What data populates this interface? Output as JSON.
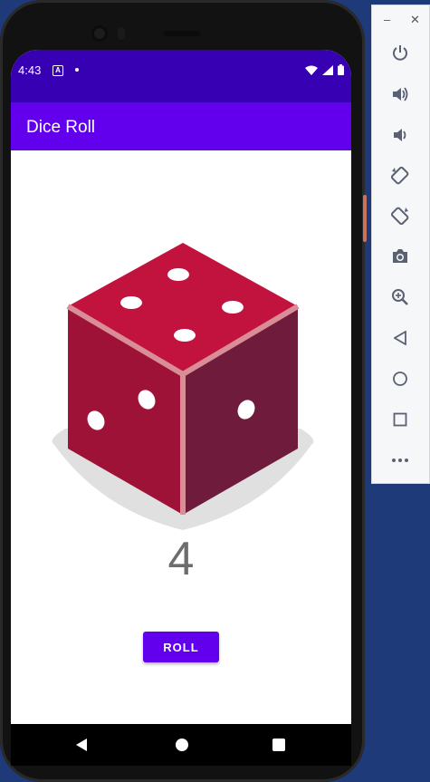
{
  "status_bar": {
    "time": "4:43",
    "notification_icon_letter": "A",
    "icons": [
      "wifi-icon",
      "signal-icon",
      "battery-icon"
    ]
  },
  "app_bar": {
    "title": "Dice Roll"
  },
  "dice": {
    "face_value": 4,
    "side_pips": 3,
    "colors": {
      "top": "#c2123e",
      "left": "#9f1238",
      "right": "#6e1b3c",
      "edge": "#d98d96",
      "pip": "#ffffff",
      "shadow": "#e0e0e0"
    }
  },
  "result": {
    "value": "4"
  },
  "roll_button": {
    "label": "ROLL"
  },
  "nav_bar": {
    "buttons": [
      "back-icon",
      "home-icon",
      "recents-icon"
    ]
  },
  "emulator_toolbar": {
    "window_controls": [
      "minimize-icon",
      "close-icon"
    ],
    "buttons": [
      "power-icon",
      "volume-up-icon",
      "volume-down-icon",
      "rotate-left-icon",
      "rotate-right-icon",
      "camera-icon",
      "zoom-icon",
      "back-icon",
      "home-icon",
      "overview-icon",
      "more-icon"
    ]
  },
  "colors": {
    "status_bar": "#3700b3",
    "app_bar": "#6200ee",
    "accent": "#6200ee",
    "background": "#1f3a78"
  }
}
